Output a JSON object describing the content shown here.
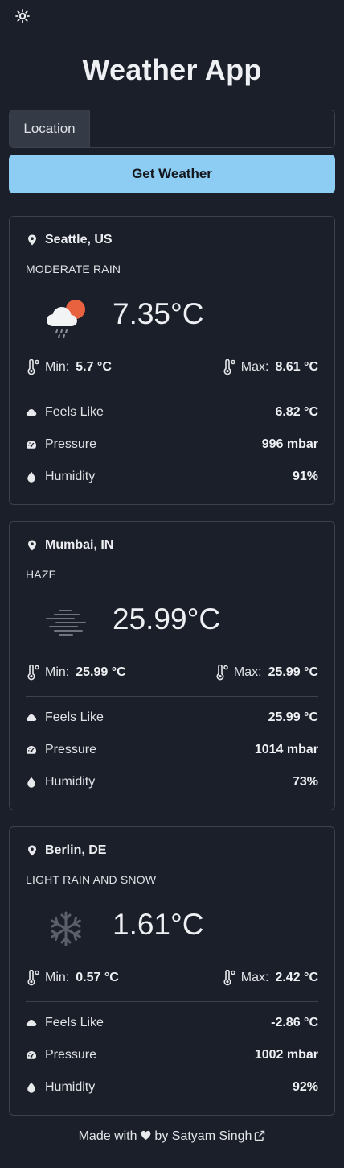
{
  "header": {
    "theme_toggle_icon": "sun-icon",
    "title": "Weather App"
  },
  "search": {
    "label": "Location",
    "value": "",
    "placeholder": "",
    "button_label": "Get Weather"
  },
  "cards": [
    {
      "location": "Seattle, US",
      "condition": "MODERATE RAIN",
      "icon": "rain-cloud-sun-icon",
      "temp": "7.35°C",
      "min_label": "Min:",
      "min": "5.7 °C",
      "max_label": "Max:",
      "max": "8.61 °C",
      "feels_label": "Feels Like",
      "feels": "6.82 °C",
      "pressure_label": "Pressure",
      "pressure": "996 mbar",
      "humidity_label": "Humidity",
      "humidity": "91%"
    },
    {
      "location": "Mumbai, IN",
      "condition": "HAZE",
      "icon": "haze-icon",
      "temp": "25.99°C",
      "min_label": "Min:",
      "min": "25.99 °C",
      "max_label": "Max:",
      "max": "25.99 °C",
      "feels_label": "Feels Like",
      "feels": "25.99 °C",
      "pressure_label": "Pressure",
      "pressure": "1014 mbar",
      "humidity_label": "Humidity",
      "humidity": "73%"
    },
    {
      "location": "Berlin, DE",
      "condition": "LIGHT RAIN AND SNOW",
      "icon": "snowflake-icon",
      "temp": "1.61°C",
      "min_label": "Min:",
      "min": "0.57 °C",
      "max_label": "Max:",
      "max": "2.42 °C",
      "feels_label": "Feels Like",
      "feels": "-2.86 °C",
      "pressure_label": "Pressure",
      "pressure": "1002 mbar",
      "humidity_label": "Humidity",
      "humidity": "92%"
    }
  ],
  "footer": {
    "made_with": "Made with",
    "by": "by",
    "author": "Satyam Singh"
  },
  "colors": {
    "background": "#1b1f29",
    "accent_button": "#8ecdf3",
    "border": "#3b414d",
    "sun": "#e8623f"
  }
}
